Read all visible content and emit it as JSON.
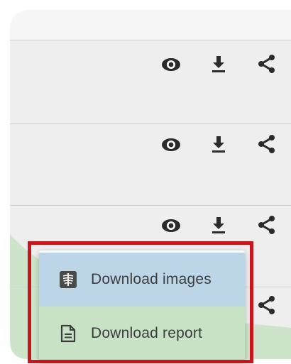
{
  "rows": [
    {
      "actions": [
        "eye-icon",
        "download-icon",
        "share-icon"
      ]
    },
    {
      "actions": [
        "eye-icon",
        "download-icon",
        "share-icon"
      ]
    },
    {
      "actions": [
        "eye-icon",
        "download-icon",
        "share-icon"
      ]
    },
    {
      "actions": [
        "share-icon"
      ]
    }
  ],
  "download_menu": {
    "items": [
      {
        "label": "Download images",
        "icon": "xray-icon",
        "highlight_color": "#bcd6e8"
      },
      {
        "label": "Download report",
        "icon": "document-icon",
        "highlight_color": "#c7e2c4"
      }
    ]
  },
  "colors": {
    "accent_highlight_box": "#c8161d",
    "wave_green": "#c7e2c4",
    "icon": "#2b2b2b"
  }
}
